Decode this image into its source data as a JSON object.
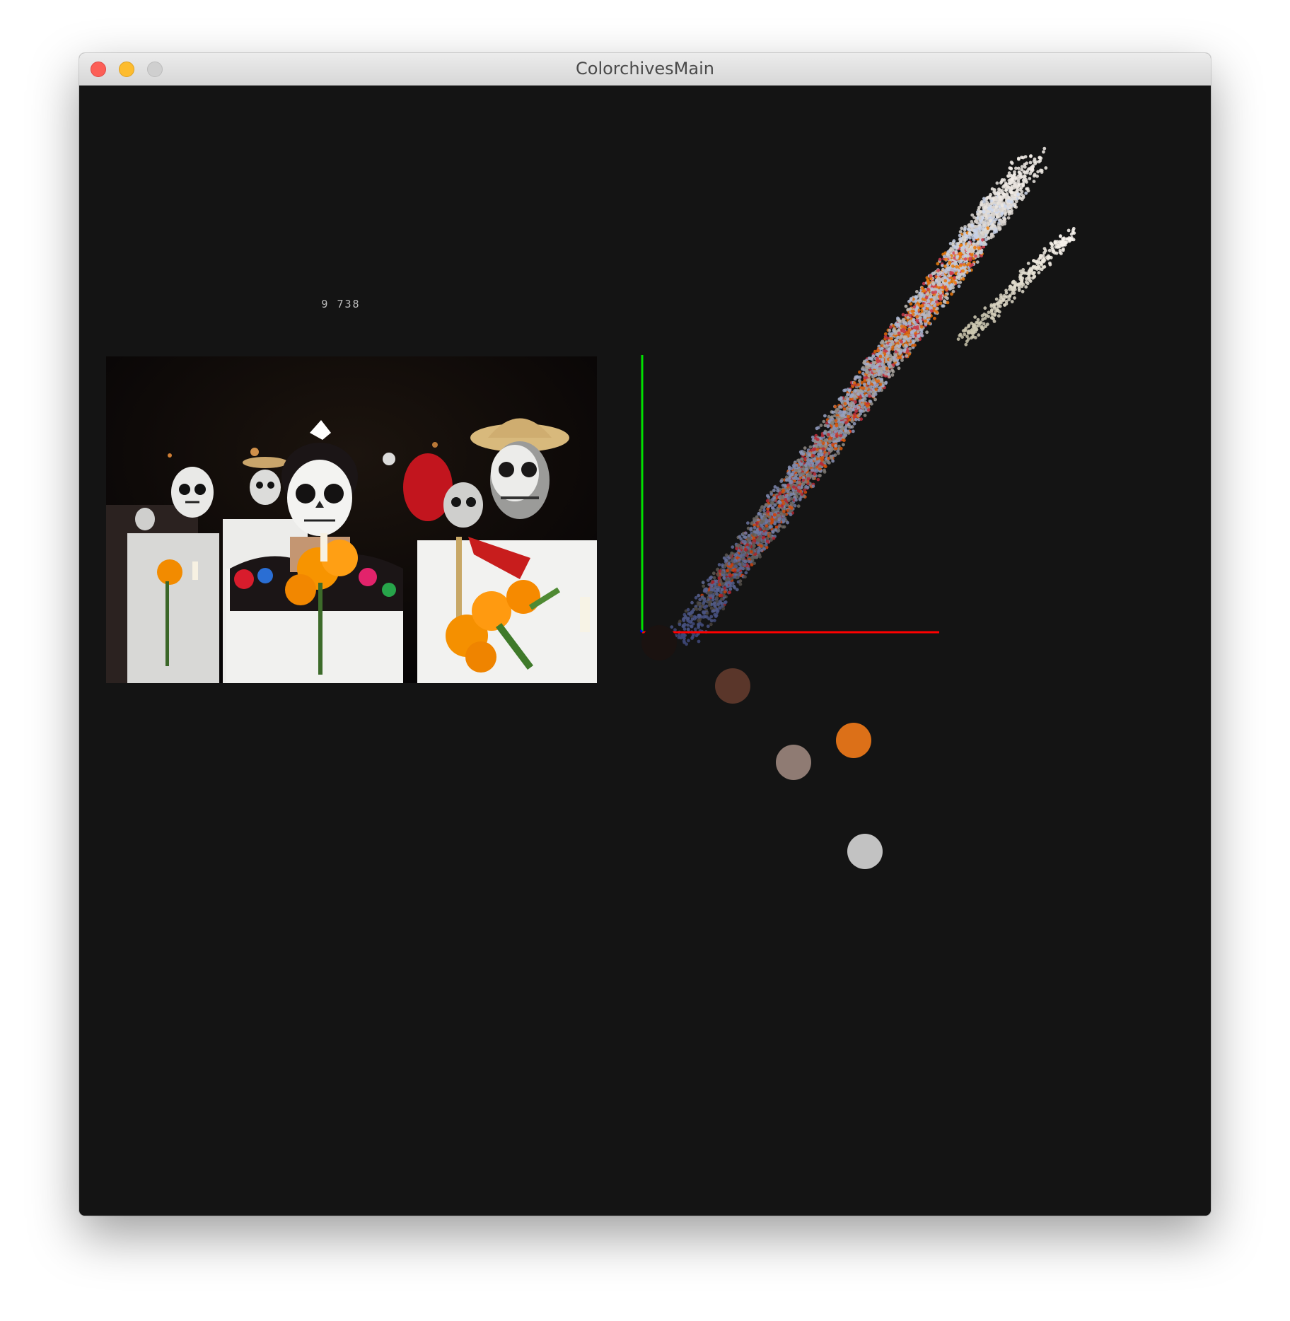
{
  "window": {
    "title": "ColorchivesMain"
  },
  "stats": {
    "count_label": "9 738"
  },
  "image": {
    "subject": "dia-de-muertos-procession-photo"
  },
  "axes": {
    "x_color": "#ff0000",
    "y_color": "#00e000",
    "z_color": "#0000ff"
  },
  "palette": [
    {
      "name": "near-black",
      "hex": "#1a1210"
    },
    {
      "name": "brown",
      "hex": "#5a362a"
    },
    {
      "name": "orange",
      "hex": "#dc7018"
    },
    {
      "name": "taupe",
      "hex": "#8f7b73"
    },
    {
      "name": "light-gray",
      "hex": "#c2c2c2"
    }
  ]
}
